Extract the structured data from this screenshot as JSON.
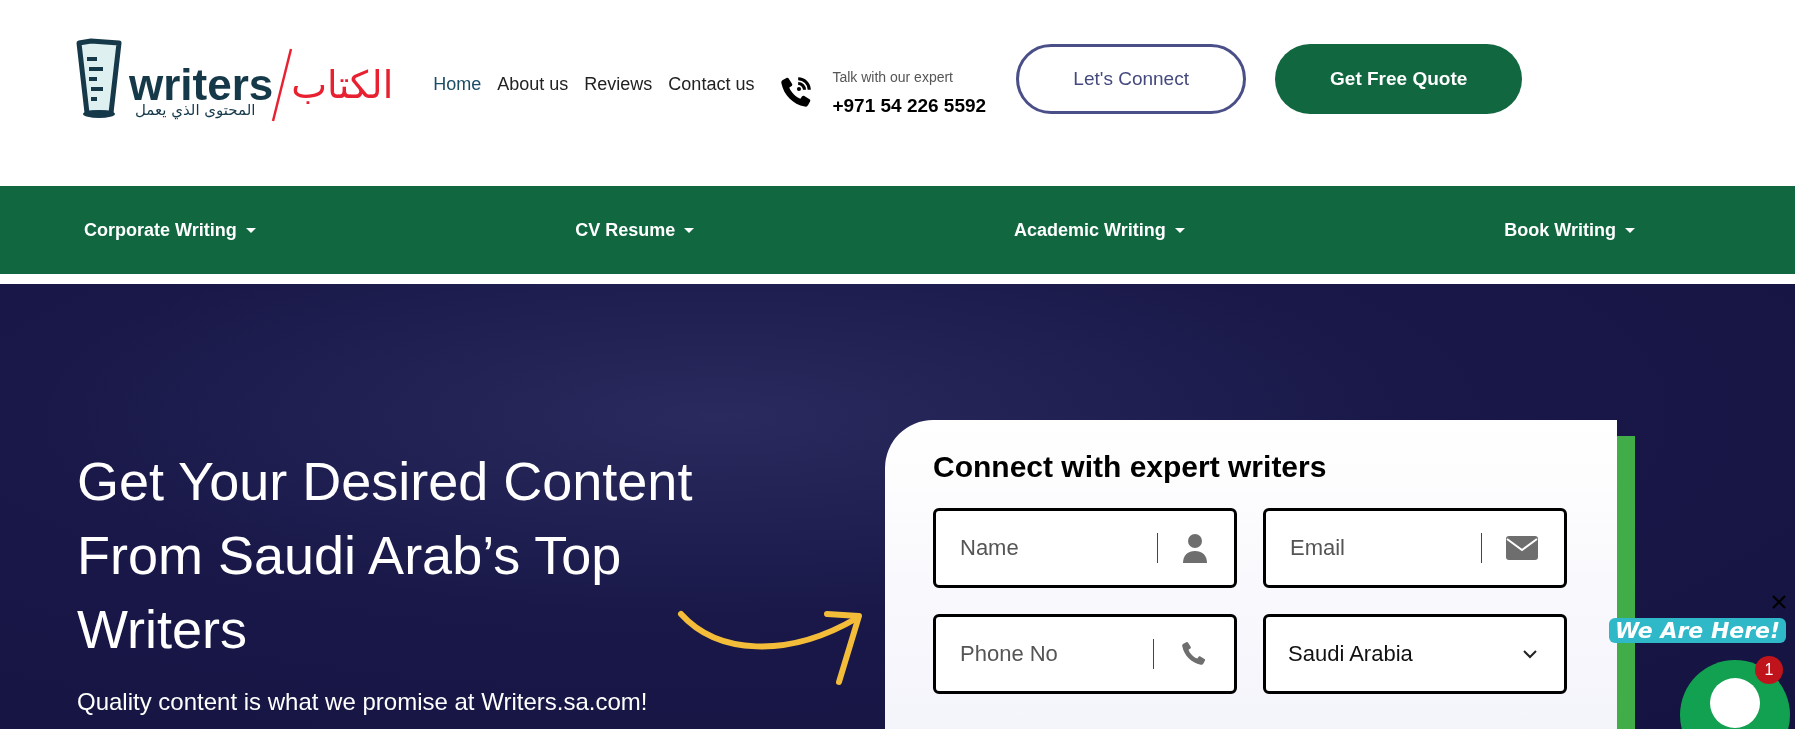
{
  "logo": {
    "wordmark": "writers",
    "arabic_name": "الكتاب",
    "tagline": "المحتوى الذي يعمل"
  },
  "nav_links": [
    {
      "label": "Home",
      "selected": true
    },
    {
      "label": "About us",
      "selected": false
    },
    {
      "label": "Reviews",
      "selected": false
    },
    {
      "label": "Contact us",
      "selected": false
    }
  ],
  "contact": {
    "caption": "Talk with our expert",
    "phone": "+971 54 226 5592"
  },
  "buttons": [
    {
      "label": "Let's Connect",
      "kind": "outline"
    },
    {
      "label": "Get Free Quote",
      "kind": "solid"
    }
  ],
  "menu": [
    {
      "label": "Corporate Writing"
    },
    {
      "label": "CV Resume"
    },
    {
      "label": "Academic Writing"
    },
    {
      "label": "Book Writing"
    }
  ],
  "hero": {
    "heading": "Get Your Desired Content From Saudi Arab’s Top Writers",
    "subtext": "Quality content is what we promise at Writers.sa.com!"
  },
  "form": {
    "title": "Connect with expert writers",
    "fields": [
      {
        "kind": "name",
        "placeholder": "Name"
      },
      {
        "kind": "email",
        "placeholder": "Email"
      },
      {
        "kind": "phone",
        "placeholder": "Phone No"
      },
      {
        "kind": "select",
        "value": "Saudi Arabia"
      }
    ]
  },
  "chat_widget": {
    "label": "We Are Here!",
    "badge": "1"
  }
}
